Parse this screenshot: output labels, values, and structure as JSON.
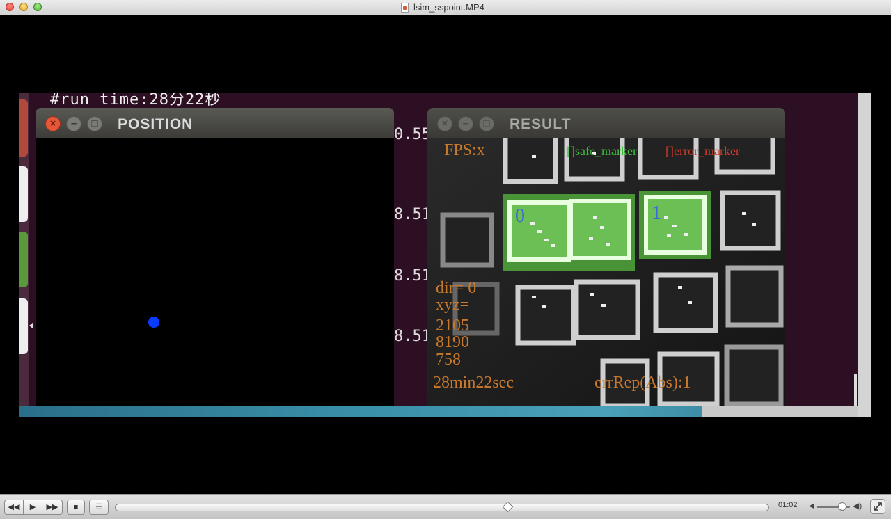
{
  "window": {
    "title": "lsim_sspoint.MP4"
  },
  "terminal": {
    "top_line": "#run  time:28分22秒",
    "numbers": [
      "0.55",
      "8.51",
      "8.51",
      "8.51"
    ]
  },
  "position_window": {
    "title": "POSITION",
    "close_glyph": "×",
    "min_glyph": "–",
    "max_glyph": "□"
  },
  "result_window": {
    "title": "RESULT",
    "close_glyph": "×",
    "min_glyph": "–",
    "max_glyph": "□",
    "fps": "FPS:x",
    "safe_marker": "[]safe_marker",
    "error_marker": "[]error_marker",
    "marker_ids": [
      "0",
      "1"
    ],
    "dir": "dir= 0",
    "xyz_label": "xyz=",
    "x": "2105",
    "y": "8190",
    "z": "758",
    "elapsed": "28min22sec",
    "err": "errRep(Abs):1"
  },
  "controller": {
    "rewind_glyph": "◀◀",
    "play_glyph": "▶",
    "ffwd_glyph": "▶▶",
    "stop_glyph": "■",
    "chapters_glyph": "☰",
    "time": "01:02",
    "playback_fraction": 0.6,
    "volume_fraction": 0.75
  },
  "colors": {
    "overlay_text": "#c8792c",
    "safe_marker": "#3bbf3b",
    "error_marker": "#cc3a2a",
    "position_dot": "#0a3cff"
  }
}
